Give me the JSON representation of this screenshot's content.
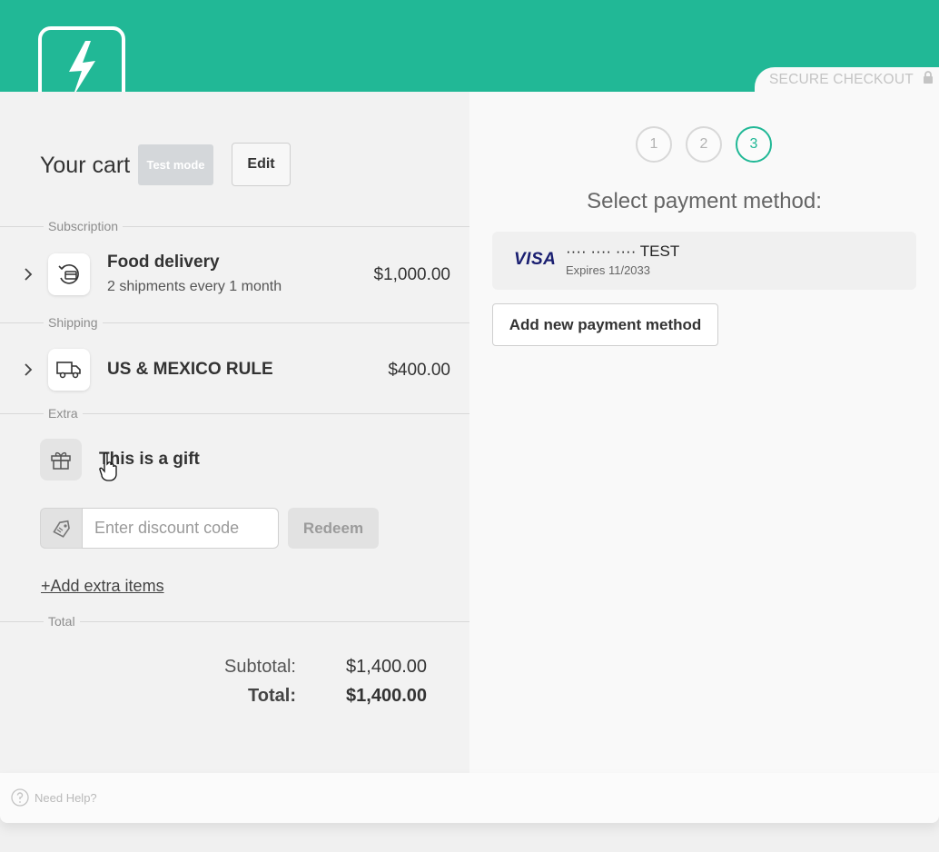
{
  "header": {
    "secure_label": "SECURE CHECKOUT"
  },
  "cart": {
    "title": "Your cart",
    "test_badge": "Test mode",
    "edit_label": "Edit",
    "sections": {
      "subscription": "Subscription",
      "shipping": "Shipping",
      "extra": "Extra",
      "total": "Total"
    },
    "subscription_item": {
      "name": "Food delivery",
      "description": "2 shipments every 1 month",
      "price": "$1,000.00"
    },
    "shipping_item": {
      "name": "US & MEXICO RULE",
      "price": "$400.00"
    },
    "gift_label": "This is a gift",
    "discount": {
      "placeholder": "Enter discount code",
      "value": "",
      "redeem_label": "Redeem"
    },
    "add_extra_label": "+Add extra items",
    "totals": {
      "subtotal_label": "Subtotal:",
      "subtotal_value": "$1,400.00",
      "total_label": "Total:",
      "total_value": "$1,400.00"
    }
  },
  "payment": {
    "steps": [
      "1",
      "2",
      "3"
    ],
    "active_step": 3,
    "title": "Select payment method:",
    "card": {
      "brand": "VISA",
      "number": "···· ···· ···· TEST",
      "expires": "Expires 11/2033"
    },
    "add_method_label": "Add new payment method"
  },
  "footer": {
    "help_label": "Need Help?"
  },
  "colors": {
    "brand": "#21b896",
    "visa": "#1a1f71"
  },
  "icons": {
    "logo": "lightning-bolt-icon",
    "lock": "lock-icon",
    "subscription": "recurring-card-icon",
    "shipping": "truck-icon",
    "gift": "gift-icon",
    "discount": "tag-icon",
    "help": "question-icon"
  }
}
